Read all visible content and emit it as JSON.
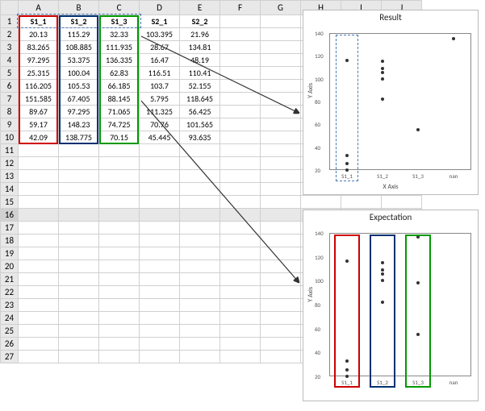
{
  "columns": [
    "A",
    "B",
    "C",
    "D",
    "E",
    "F",
    "G",
    "H",
    "I",
    "J"
  ],
  "rows": [
    1,
    2,
    3,
    4,
    5,
    6,
    7,
    8,
    9,
    10,
    11,
    12,
    13,
    14,
    15,
    16,
    17,
    18,
    19,
    20,
    21,
    22,
    23,
    24,
    25,
    26,
    27
  ],
  "headers": {
    "A": "S1_1",
    "B": "S1_2",
    "C": "S1_3",
    "D": "S2_1",
    "E": "S2_2"
  },
  "table": {
    "2": {
      "A": "20.13",
      "B": "115.29",
      "C": "32.33",
      "D": "103.395",
      "E": "21.96"
    },
    "3": {
      "A": "83.265",
      "B": "108.885",
      "C": "111.935",
      "D": "28.67",
      "E": "134.81"
    },
    "4": {
      "A": "97.295",
      "B": "53.375",
      "C": "136.335",
      "D": "16.47",
      "E": "48.19"
    },
    "5": {
      "A": "25.315",
      "B": "100.04",
      "C": "62.83",
      "D": "116.51",
      "E": "110.41"
    },
    "6": {
      "A": "116.205",
      "B": "105.53",
      "C": "66.185",
      "D": "103.7",
      "E": "52.155"
    },
    "7": {
      "A": "151.585",
      "B": "67.405",
      "C": "88.145",
      "D": "5.795",
      "E": "118.645"
    },
    "8": {
      "A": "89.67",
      "B": "97.295",
      "C": "71.065",
      "D": "111.325",
      "E": "56.425"
    },
    "9": {
      "A": "59.17",
      "B": "148.23",
      "C": "74.725",
      "D": "70.76",
      "E": "101.565"
    },
    "10": {
      "A": "42.09",
      "B": "138.775",
      "C": "70.15",
      "D": "45.445",
      "E": "93.635"
    }
  },
  "selected_row": 16,
  "chart_data": [
    {
      "id": "result",
      "title": "Result",
      "type": "scatter",
      "xlabel": "X Axis",
      "ylabel": "Y Axis",
      "ylim": [
        20,
        140
      ],
      "categories": [
        "S1_1",
        "S1_2",
        "S1_3",
        "nan"
      ],
      "series": [
        {
          "name": "S1_1",
          "values": [
            20.13,
            25.315,
            33,
            116.205
          ]
        },
        {
          "name": "S1_2",
          "values": [
            82,
            100.04,
            105.53,
            108.885,
            115.29
          ]
        },
        {
          "name": "S1_3",
          "values": [
            55
          ]
        },
        {
          "name": "nan",
          "values": [
            135
          ]
        }
      ],
      "highlight": "S1_1"
    },
    {
      "id": "expectation",
      "title": "Expectation",
      "type": "scatter",
      "xlabel": "",
      "ylabel": "Y Axis",
      "ylim": [
        20,
        140
      ],
      "categories": [
        "S1_1",
        "S1_2",
        "S1_3",
        "nan"
      ],
      "series": [
        {
          "name": "S1_1",
          "values": [
            20.13,
            25.315,
            33,
            116.205
          ]
        },
        {
          "name": "S1_2",
          "values": [
            82,
            100.04,
            105.53,
            108.885,
            115.29
          ]
        },
        {
          "name": "S1_3",
          "values": [
            55,
            98,
            136.335
          ]
        },
        {
          "name": "nan",
          "values": []
        }
      ],
      "box_colors": {
        "S1_1": "#c00",
        "S1_2": "#003070",
        "S1_3": "#090"
      }
    }
  ]
}
